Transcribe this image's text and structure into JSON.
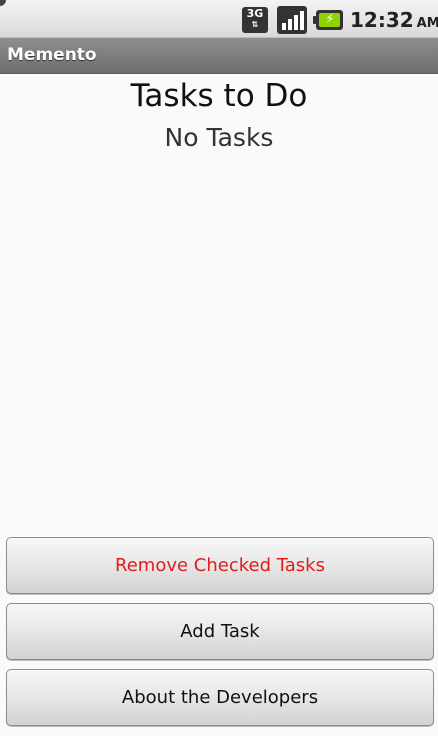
{
  "status_bar": {
    "network_label": "3G",
    "network_arrows": "⇅",
    "battery_bolt": "⚡",
    "time": "12:32",
    "ampm": "AM",
    "icons": [
      "3g-icon",
      "signal-icon",
      "battery-icon"
    ]
  },
  "title_bar": {
    "title": "Memento"
  },
  "main": {
    "heading": "Tasks to Do",
    "empty_message": "No Tasks"
  },
  "buttons": {
    "remove_checked": {
      "label": "Remove Checked Tasks",
      "color": "#e31b1b"
    },
    "add_task": {
      "label": "Add Task"
    },
    "about": {
      "label": "About the Developers"
    }
  }
}
